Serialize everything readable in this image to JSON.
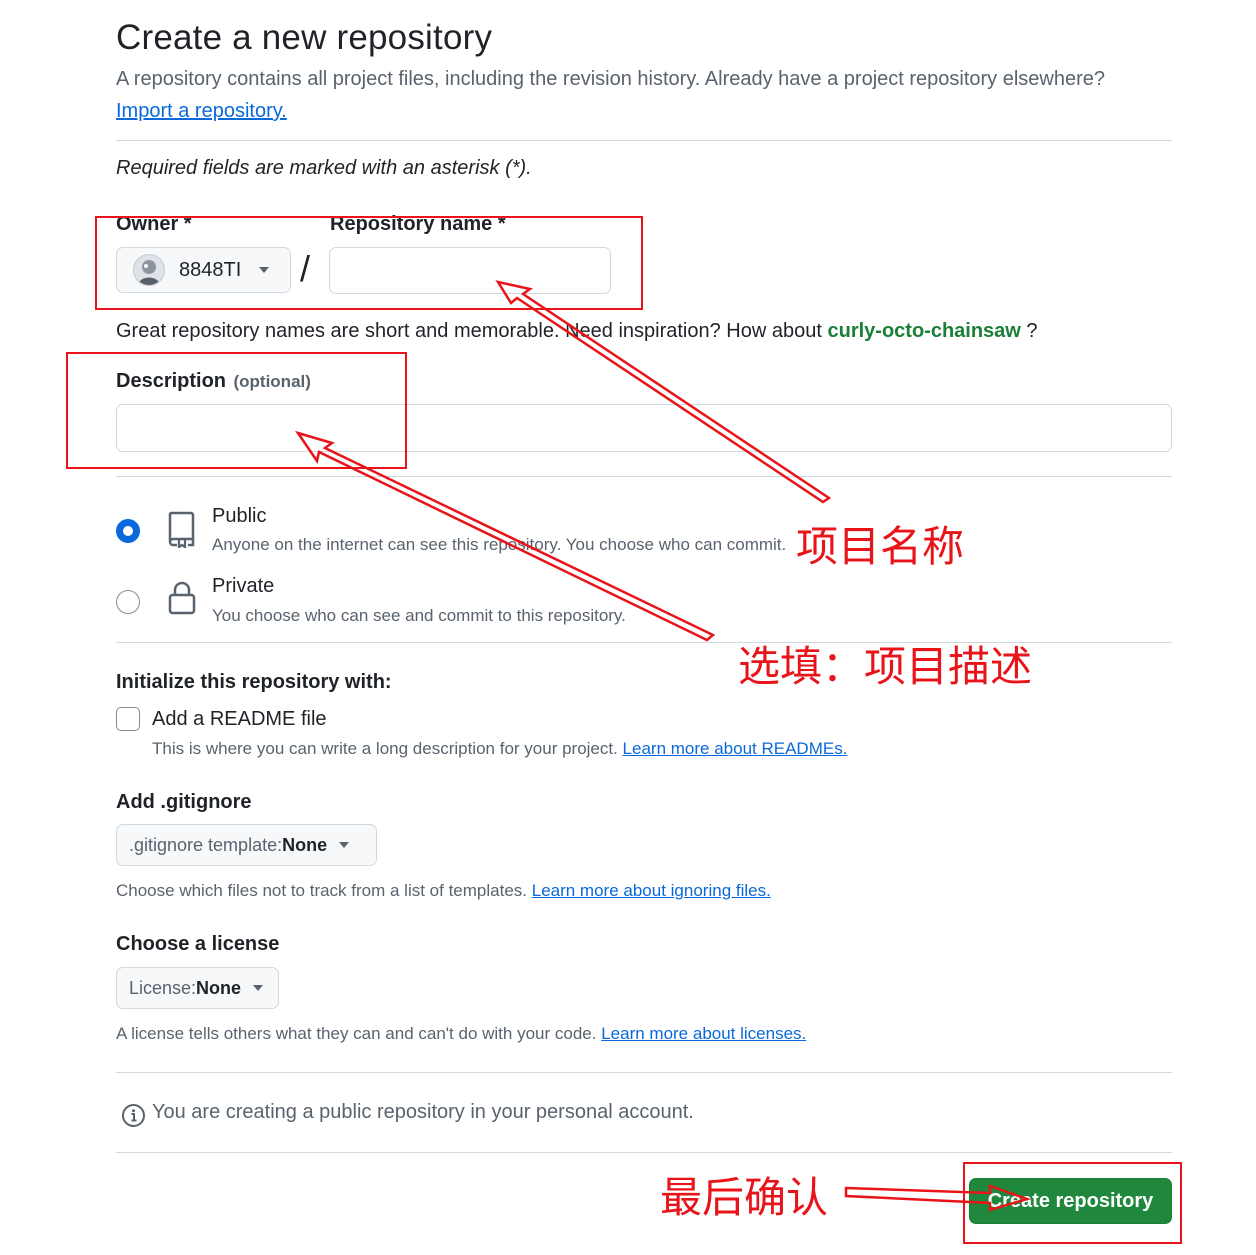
{
  "header": {
    "title": "Create a new repository",
    "subtitle": "A repository contains all project files, including the revision history. Already have a project repository elsewhere?",
    "import_link": "Import a repository."
  },
  "required_note": "Required fields are marked with an asterisk (*).",
  "owner": {
    "label": "Owner *",
    "value": "8848TI"
  },
  "slash": "/",
  "repo_name": {
    "label": "Repository name *",
    "value": ""
  },
  "name_hint": {
    "text": "Great repository names are short and memorable. Need inspiration? How about ",
    "suggestion": "curly-octo-chainsaw",
    "suffix": " ?"
  },
  "description": {
    "label": "Description",
    "optional": "(optional)",
    "value": ""
  },
  "visibility": {
    "public": {
      "title": "Public",
      "desc": "Anyone on the internet can see this repository. You choose who can commit.",
      "selected": true
    },
    "private": {
      "title": "Private",
      "desc": "You choose who can see and commit to this repository.",
      "selected": false
    }
  },
  "initialize": {
    "heading": "Initialize this repository with:",
    "readme_label": "Add a README file",
    "readme_desc": "This is where you can write a long description for your project. ",
    "readme_link": "Learn more about READMEs."
  },
  "gitignore": {
    "heading": "Add .gitignore",
    "prefix": ".gitignore template: ",
    "value": "None",
    "desc": "Choose which files not to track from a list of templates. ",
    "link": "Learn more about ignoring files."
  },
  "license": {
    "heading": "Choose a license",
    "prefix": "License: ",
    "value": "None",
    "desc": "A license tells others what they can and can't do with your code. ",
    "link": "Learn more about licenses."
  },
  "notice": "You are creating a public repository in your personal account.",
  "create_button": "Create repository",
  "annotations": {
    "repo_name": "项目名称",
    "description": "选填：项目描述",
    "confirm": "最后确认"
  },
  "colors": {
    "accent": "#0969da",
    "green": "#1f883d",
    "annotation_red": "#e8141a"
  }
}
